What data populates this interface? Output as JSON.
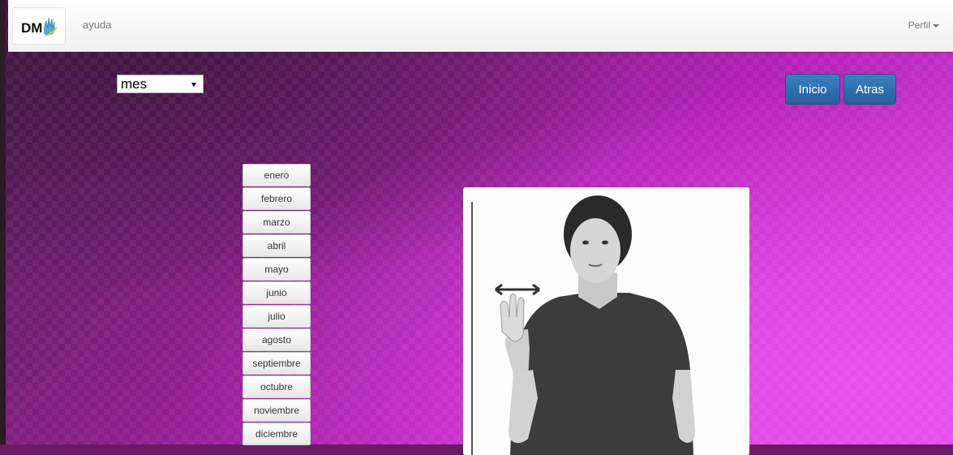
{
  "navbar": {
    "help_label": "ayuda",
    "profile_label": "Perfil",
    "logo_icon": "dm-hand-logo-icon"
  },
  "controls": {
    "category_select_value": "mes"
  },
  "actions": {
    "home_label": "Inicio",
    "back_label": "Atras"
  },
  "months": [
    "enero",
    "febrero",
    "marzo",
    "abril",
    "mayo",
    "junio",
    "julio",
    "agosto",
    "septiembre",
    "octubre",
    "noviembre",
    "diciembre"
  ],
  "colors": {
    "button_blue": "#2f6fad",
    "background_purple": "#b21fb4"
  }
}
